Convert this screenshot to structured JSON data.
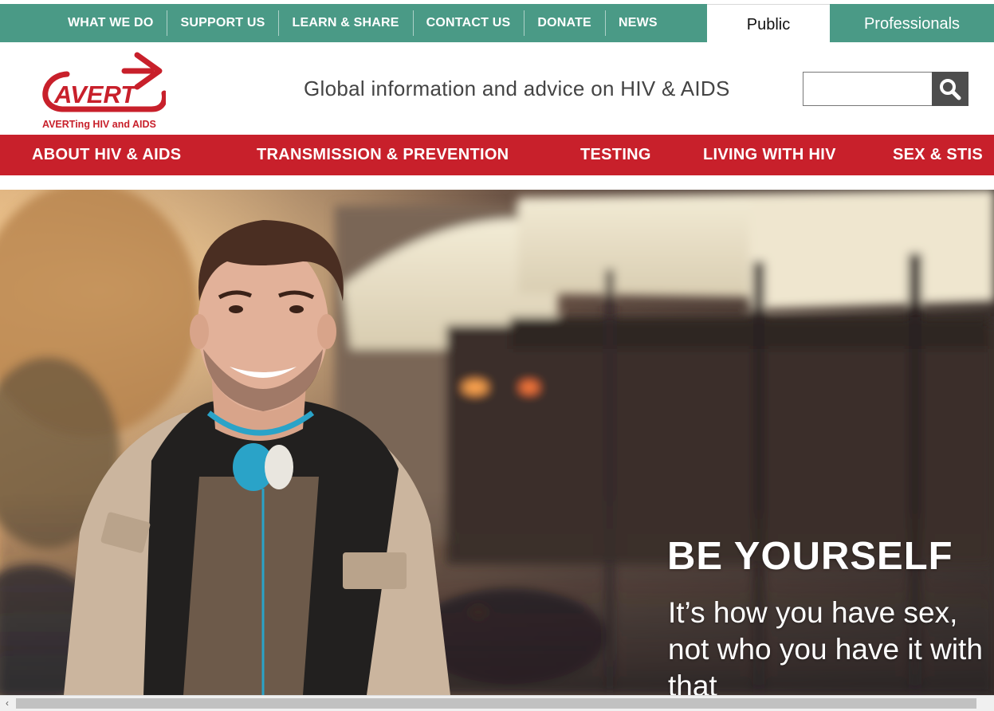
{
  "utility_nav": {
    "links": [
      "WHAT WE DO",
      "SUPPORT US",
      "LEARN & SHARE",
      "CONTACT US",
      "DONATE",
      "NEWS"
    ],
    "audience_tabs": {
      "active": "Public",
      "other": "Professionals"
    }
  },
  "header": {
    "logo_wordmark": "AVERT",
    "logo_tagline": "AVERTing HIV and AIDS",
    "tagline": "Global information and advice on HIV & AIDS",
    "search": {
      "value": "",
      "placeholder": ""
    }
  },
  "main_nav": {
    "items": [
      "ABOUT HIV & AIDS",
      "TRANSMISSION & PREVENTION",
      "TESTING",
      "LIVING WITH HIV",
      "SEX & STIS"
    ]
  },
  "hero": {
    "title": "BE YOURSELF",
    "subtitle": "It’s how you have sex, not who you have it with that"
  },
  "colors": {
    "utility_green": "#4a9a86",
    "brand_red": "#c8202b",
    "search_button": "#4d4d4d",
    "tagline_text": "#444444"
  },
  "icons": {
    "search_button": "magnifier-icon",
    "scroll_left": "arrow-left-icon"
  }
}
